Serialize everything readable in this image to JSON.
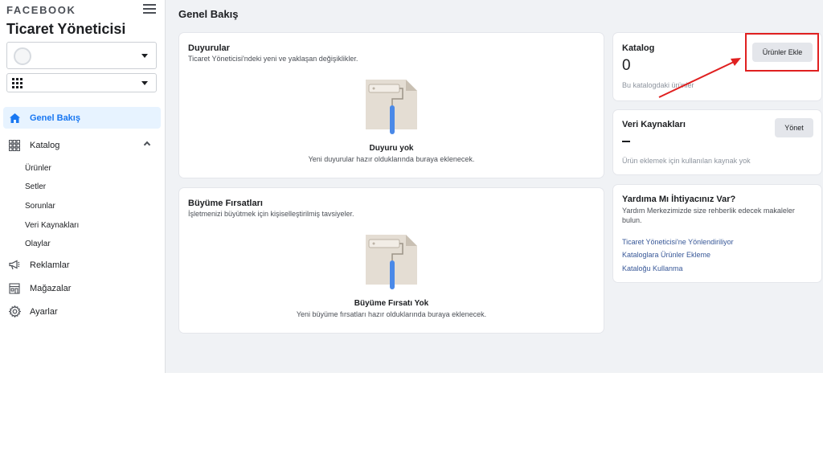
{
  "sidebar": {
    "brand": "FACEBOOK",
    "app_title": "Ticaret Yöneticisi",
    "nav": [
      {
        "label": "Genel Bakış",
        "icon": "home-icon",
        "active": true
      },
      {
        "label": "Katalog",
        "icon": "grid-icon"
      },
      {
        "label": "Reklamlar",
        "icon": "megaphone-icon"
      },
      {
        "label": "Mağazalar",
        "icon": "shop-icon"
      },
      {
        "label": "Ayarlar",
        "icon": "gear-icon"
      }
    ],
    "catalog_sub": [
      "Ürünler",
      "Setler",
      "Sorunlar",
      "Veri Kaynakları",
      "Olaylar"
    ]
  },
  "main": {
    "page_title": "Genel Bakış",
    "announcements": {
      "title": "Duyurular",
      "subtitle": "Ticaret Yöneticisi'ndeki yeni ve yaklaşan değişiklikler.",
      "empty_title": "Duyuru yok",
      "empty_desc": "Yeni duyurular hazır olduklarında buraya eklenecek."
    },
    "growth": {
      "title": "Büyüme Fırsatları",
      "subtitle": "İşletmenizi büyütmek için kişiselleştirilmiş tavsiyeler.",
      "empty_title": "Büyüme Fırsatı Yok",
      "empty_desc": "Yeni büyüme fırsatları hazır olduklarında buraya eklenecek."
    },
    "catalog": {
      "title": "Katalog",
      "count": "0",
      "desc": "Bu katalogdaki ürünler",
      "button": "Ürünler Ekle"
    },
    "data_sources": {
      "title": "Veri Kaynakları",
      "desc": "Ürün eklemek için kullanılan kaynak yok",
      "button": "Yönet"
    },
    "help": {
      "title": "Yardıma Mı İhtiyacınız Var?",
      "desc": "Yardım Merkezimizde size rehberlik edecek makaleler bulun.",
      "links": [
        "Ticaret Yöneticisi'ne Yönlendiriliyor",
        "Kataloglara Ürünler Ekleme",
        "Kataloğu Kullanma"
      ]
    }
  },
  "colors": {
    "accent": "#1877f2",
    "annotation": "#e02020"
  }
}
